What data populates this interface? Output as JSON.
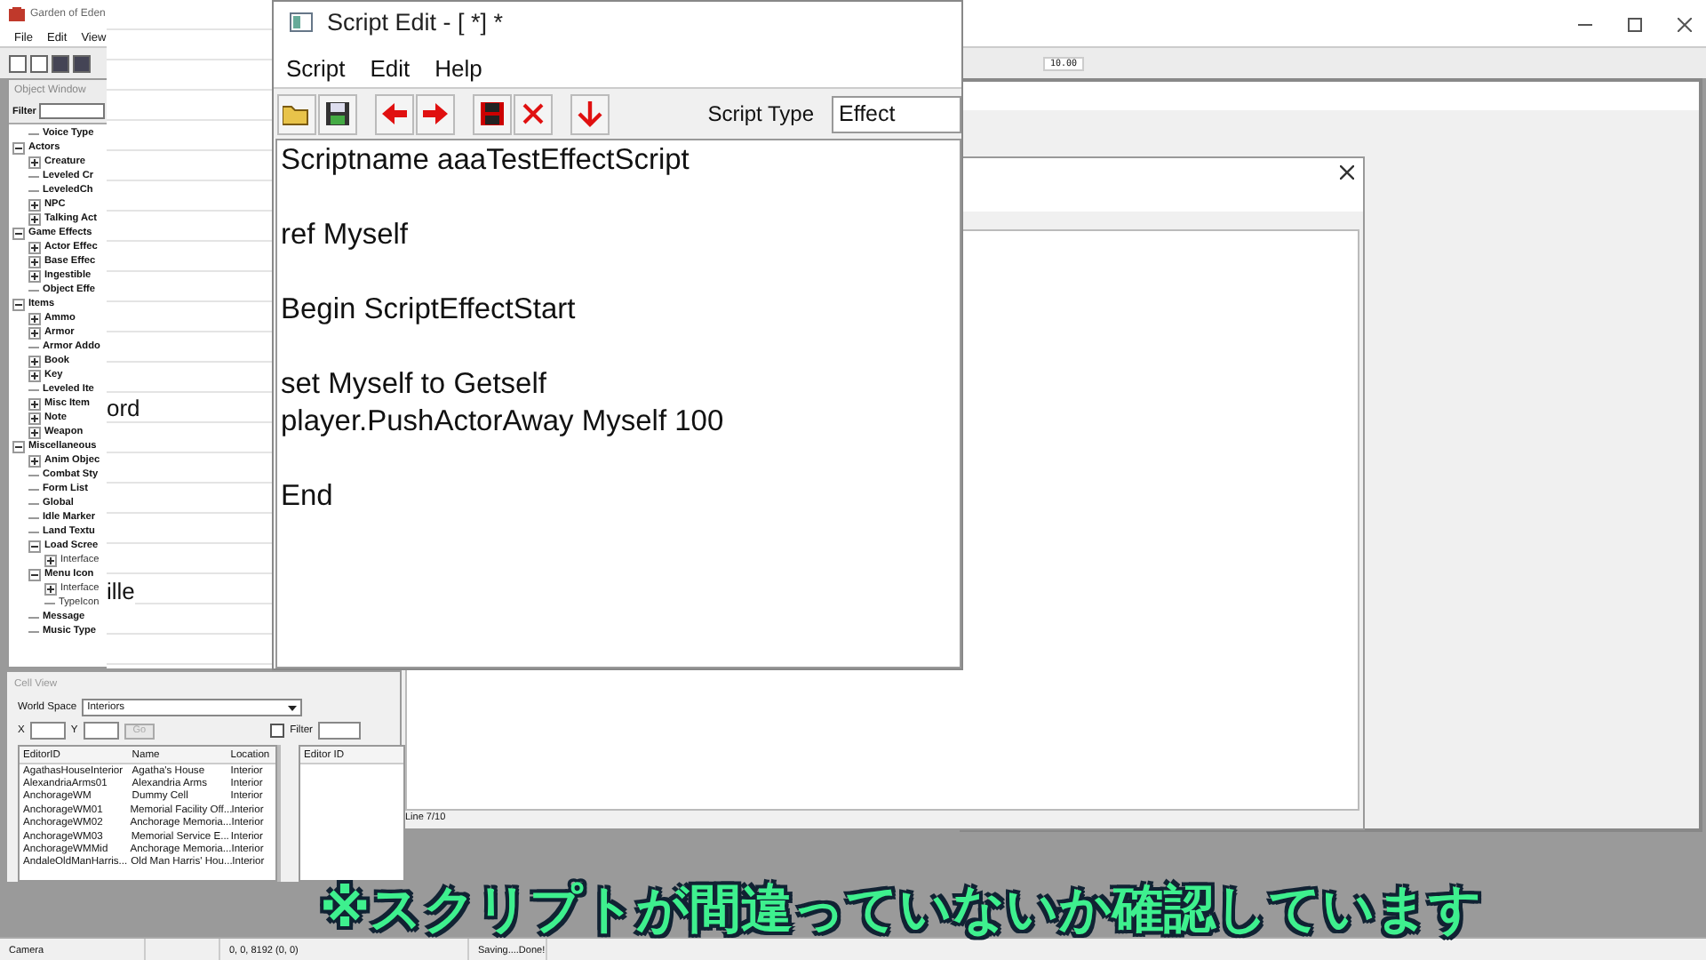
{
  "main_window": {
    "title": "Garden of Eden",
    "menu": [
      "File",
      "Edit",
      "View"
    ],
    "toolbar_field": "10.00"
  },
  "background_panel": {
    "texts": [
      "ord",
      "ille"
    ]
  },
  "object_window": {
    "title": "Object Window",
    "filter_label": "Filter",
    "tree": [
      {
        "kind": "continued",
        "children": [
          {
            "label": "Voice Type",
            "kind": "leaf"
          }
        ]
      },
      {
        "label": "Actors",
        "kind": "group",
        "expanded": true,
        "children": [
          {
            "label": "Creature",
            "kind": "group",
            "expanded": false
          },
          {
            "label": "Leveled Cr",
            "kind": "leaf"
          },
          {
            "label": "LeveledCh",
            "kind": "leaf"
          },
          {
            "label": "NPC",
            "kind": "group",
            "expanded": false
          },
          {
            "label": "Talking Act",
            "kind": "group",
            "expanded": false
          }
        ]
      },
      {
        "label": "Game Effects",
        "kind": "group",
        "expanded": true,
        "children": [
          {
            "label": "Actor Effec",
            "kind": "group",
            "expanded": false
          },
          {
            "label": "Base Effec",
            "kind": "group",
            "expanded": false
          },
          {
            "label": "Ingestible",
            "kind": "group",
            "expanded": false
          },
          {
            "label": "Object Effe",
            "kind": "leaf"
          }
        ]
      },
      {
        "label": "Items",
        "kind": "group",
        "expanded": true,
        "children": [
          {
            "label": "Ammo",
            "kind": "group",
            "expanded": false
          },
          {
            "label": "Armor",
            "kind": "group",
            "expanded": false
          },
          {
            "label": "Armor Addo",
            "kind": "leaf"
          },
          {
            "label": "Book",
            "kind": "group",
            "expanded": false
          },
          {
            "label": "Key",
            "kind": "group",
            "expanded": false
          },
          {
            "label": "Leveled Ite",
            "kind": "leaf"
          },
          {
            "label": "Misc Item",
            "kind": "group",
            "expanded": false
          },
          {
            "label": "Note",
            "kind": "group",
            "expanded": false
          },
          {
            "label": "Weapon",
            "kind": "group",
            "expanded": false
          }
        ]
      },
      {
        "label": "Miscellaneous",
        "kind": "group",
        "expanded": true,
        "children": [
          {
            "label": "Anim Objec",
            "kind": "group",
            "expanded": false
          },
          {
            "label": "Combat Sty",
            "kind": "leaf"
          },
          {
            "label": "Form List",
            "kind": "leaf"
          },
          {
            "label": "Global",
            "kind": "leaf"
          },
          {
            "label": "Idle Marker",
            "kind": "leaf"
          },
          {
            "label": "Land Textu",
            "kind": "leaf"
          },
          {
            "label": "Load Scree",
            "kind": "group",
            "expanded": true,
            "children": [
              {
                "label": "Interface",
                "kind": "group",
                "expanded": false
              }
            ]
          },
          {
            "label": "Menu Icon",
            "kind": "group",
            "expanded": true,
            "children": [
              {
                "label": "Interface",
                "kind": "group",
                "expanded": false
              },
              {
                "label": "TypeIcon",
                "kind": "leaf"
              }
            ]
          },
          {
            "label": "Message",
            "kind": "leaf"
          },
          {
            "label": "Music Type",
            "kind": "leaf"
          }
        ]
      }
    ]
  },
  "script_edit": {
    "title": "Script Edit - [ *] *",
    "menu": [
      "Script",
      "Edit",
      "Help"
    ],
    "script_type_label": "Script Type",
    "script_type": "Effect",
    "script": "Scriptname aaaTestEffectScript\n\nref Myself\n\nBegin ScriptEffectStart\n\nset Myself to Getself\nplayer.PushActorAway Myself 100\n\nEnd"
  },
  "dialog": {
    "status": "Line 7/10"
  },
  "cell_view": {
    "title": "Cell View",
    "world_space_label": "World Space",
    "world_space": "Interiors",
    "x_label": "X",
    "y_label": "Y",
    "go": {
      "label": "Go",
      "disabled": true
    },
    "filter": {
      "label": "Filter",
      "checked": false
    },
    "columns": [
      "EditorID",
      "Name",
      "Location"
    ],
    "rows": [
      [
        "AgathasHouseInterior",
        "Agatha's House",
        "Interior"
      ],
      [
        "AlexandriaArms01",
        "Alexandria Arms",
        "Interior"
      ],
      [
        "AnchorageWM",
        "Dummy Cell",
        "Interior"
      ],
      [
        "AnchorageWM01",
        "Memorial Facility Off...",
        "Interior"
      ],
      [
        "AnchorageWM02",
        "Anchorage Memoria...",
        "Interior"
      ],
      [
        "AnchorageWM03",
        "Memorial Service E...",
        "Interior"
      ],
      [
        "AnchorageWMMid",
        "Anchorage Memoria...",
        "Interior"
      ],
      [
        "AndaleOldManHarris...",
        "Old Man Harris' Hou...",
        "Interior"
      ]
    ],
    "ref_columns": [
      "Editor ID"
    ]
  },
  "status_bar": [
    "Camera",
    "0, 0, 8192 (0, 0)",
    "Saving....Done!"
  ],
  "subtitle": "※スクリプトが間違っていないか確認しています"
}
